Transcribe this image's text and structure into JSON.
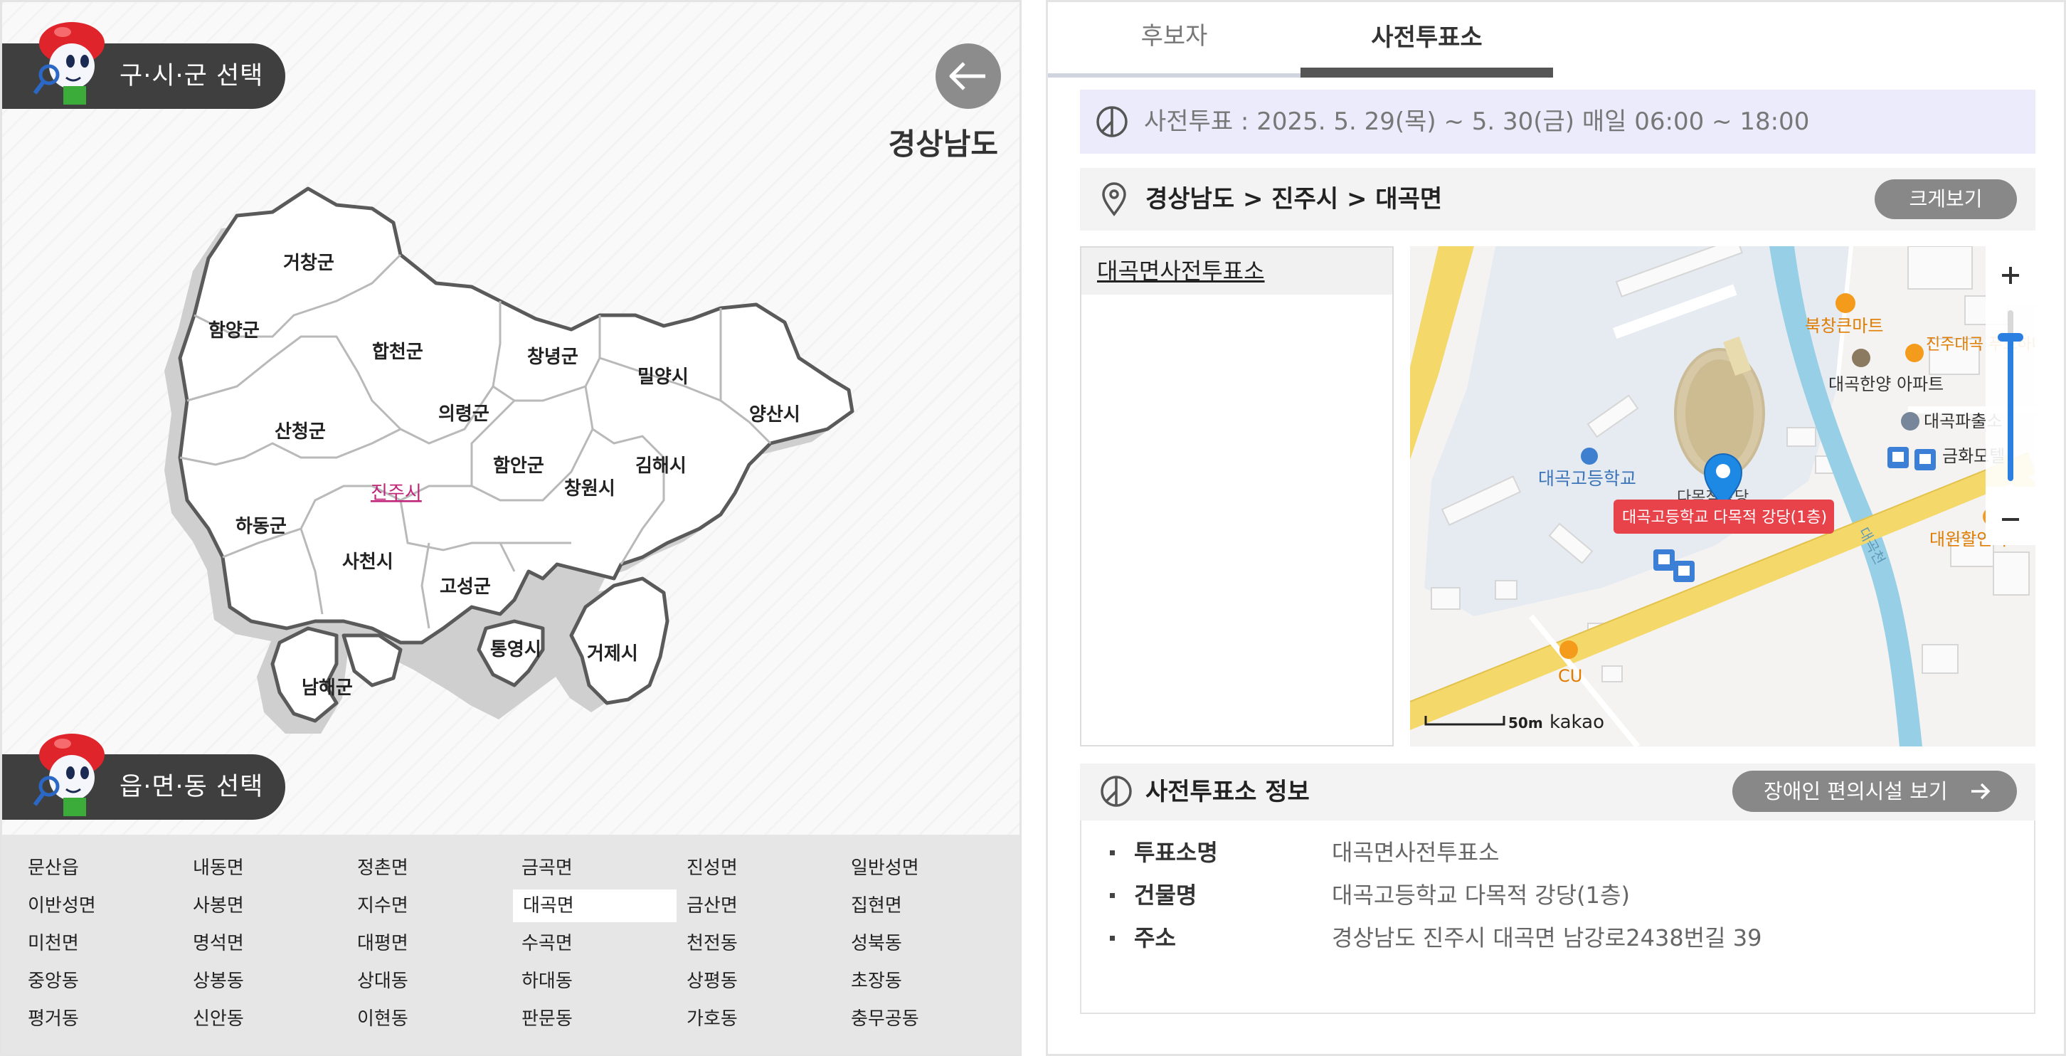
{
  "left": {
    "sigungu_title": "구·시·군 선택",
    "emd_title": "읍·면·동 선택",
    "region_name": "경상남도",
    "map_labels": [
      "거창군",
      "함양군",
      "합천군",
      "창녕군",
      "밀양시",
      "양산시",
      "산청군",
      "의령군",
      "함안군",
      "김해시",
      "진주시",
      "창원시",
      "하동군",
      "사천시",
      "고성군",
      "통영시",
      "거제시",
      "남해군"
    ],
    "selected_sigungu": "진주시",
    "dongs": [
      [
        "문산읍",
        "내동면",
        "정촌면",
        "금곡면",
        "진성면",
        "일반성면"
      ],
      [
        "이반성면",
        "사봉면",
        "지수면",
        "대곡면",
        "금산면",
        "집현면"
      ],
      [
        "미천면",
        "명석면",
        "대평면",
        "수곡면",
        "천전동",
        "성북동"
      ],
      [
        "중앙동",
        "상봉동",
        "상대동",
        "하대동",
        "상평동",
        "초장동"
      ],
      [
        "평거동",
        "신안동",
        "이현동",
        "판문동",
        "가호동",
        "충무공동"
      ]
    ],
    "selected_dong": "대곡면"
  },
  "right": {
    "tabs": [
      "후보자",
      "사전투표소"
    ],
    "active_tab": "사전투표소",
    "notice": "사전투표 : 2025. 5. 29(목) ~ 5. 30(금) 매일 06:00 ~ 18:00",
    "breadcrumb": "경상남도 > 진주시 > 대곡면",
    "big_view_label": "크게보기",
    "station_list": [
      "대곡면사전투표소"
    ],
    "map": {
      "marker_label": "대곡고등학교 다목적 강당(1층)",
      "places": [
        "북창큰마트",
        "대곡한양 아파트",
        "대곡고등학교",
        "다목적강당",
        "진주대곡 푸드하나로마트",
        "대곡파출소",
        "금화모텔",
        "대원할인마트",
        "대곡천",
        "CU"
      ],
      "scale_label": "50m",
      "brand": "kakao"
    },
    "info_title": "사전투표소 정보",
    "access_label": "장애인 편의시설 보기",
    "info_rows": [
      {
        "label": "투표소명",
        "value": "대곡면사전투표소"
      },
      {
        "label": "건물명",
        "value": "대곡고등학교 다목적 강당(1층)"
      },
      {
        "label": "주소",
        "value": "경상남도 진주시 대곡면 남강로2438번길 39"
      }
    ]
  },
  "colors": {
    "accent_pink": "#c0257a",
    "marker_blue": "#1e88e5",
    "marker_red": "#e8424a",
    "pill_dark": "#3f3f3f",
    "notice_bg": "#ebebfc"
  }
}
